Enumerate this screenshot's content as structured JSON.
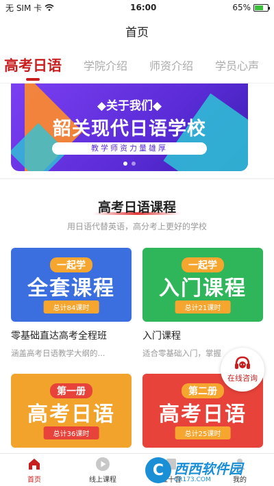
{
  "status_bar": {
    "carrier": "无 SIM 卡",
    "time": "16:00",
    "battery": "65%",
    "battery_level": 0.65
  },
  "navbar": {
    "title": "首页"
  },
  "tabs": [
    {
      "label": "高考日语",
      "active": true
    },
    {
      "label": "学院介绍"
    },
    {
      "label": "师资介绍"
    },
    {
      "label": "学员心声"
    }
  ],
  "banner": {
    "about": "◆关于我们◆",
    "school": "韶关现代日语学校",
    "motto": "教学师资力量雄厚"
  },
  "section": {
    "title": "高考日语课程",
    "subtitle": "用日语代替英语，高分考上更好的学校"
  },
  "courses": [
    {
      "tag": "一起学",
      "big": "全套课程",
      "hours": "总计84课时",
      "title": "零基础直达高考全程班",
      "desc": "涵盖高考日语教学大纲的...",
      "color": "#3b6fe0"
    },
    {
      "tag": "一起学",
      "big": "入门课程",
      "hours": "总计21课时",
      "title": "入门课程",
      "desc": "适合零基础入门，掌握",
      "color": "#2fb55a"
    },
    {
      "tag": "第一册",
      "big": "高考日语",
      "hours": "总计36课时",
      "title": "",
      "desc": "",
      "color": "#f2a32b"
    },
    {
      "tag": "第二册",
      "big": "高考日语",
      "hours": "总计25课时",
      "title": "",
      "desc": "",
      "color": "#e8433a"
    }
  ],
  "consult": {
    "label": "在线咨询"
  },
  "bottom_nav": [
    {
      "label": "首页",
      "icon": "home-icon",
      "active": true
    },
    {
      "label": "线上课程",
      "icon": "play-icon"
    },
    {
      "label": "五十音",
      "icon": "book-icon"
    },
    {
      "label": "我的",
      "icon": "user-icon"
    }
  ],
  "watermark": {
    "logo": "C",
    "main": "西西软件园",
    "sub": "CR173.COM"
  },
  "colors": {
    "accent": "#c81e1e"
  }
}
